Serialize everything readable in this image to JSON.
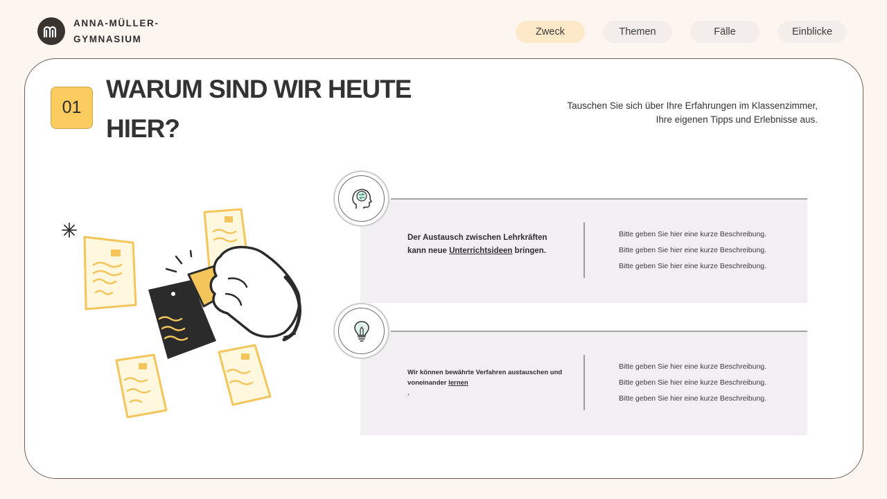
{
  "header": {
    "brand_name": "ANNA-MÜLLER-GYMNASIUM",
    "nav": [
      {
        "label": "Zweck",
        "active": true
      },
      {
        "label": "Themen",
        "active": false
      },
      {
        "label": "Fälle",
        "active": false
      },
      {
        "label": "Einblicke",
        "active": false
      }
    ]
  },
  "slide": {
    "number": "01",
    "title": "WARUM SIND WIR HEUTE HIER?",
    "subtitle_line1": "Tauschen Sie sich über Ihre Erfahrungen im Klassenzimmer,",
    "subtitle_line2": "Ihre eigenen Tipps und Erlebnisse aus."
  },
  "rows": [
    {
      "icon": "head-exchange-icon",
      "text_before": "Der Austausch zwischen Lehrkräften kann neue ",
      "text_link": "Unterrichtsideen",
      "text_after": " bringen.",
      "descriptions": [
        "Bitte geben Sie hier eine kurze Beschreibung.",
        "Bitte geben Sie hier eine kurze Beschreibung.",
        "Bitte geben Sie hier eine kurze Beschreibung."
      ]
    },
    {
      "icon": "lightbulb-icon",
      "text_before": "Wir können bewährte Verfahren austauschen und voneinander ",
      "text_link": "lernen",
      "text_after": "",
      "text_extra": ".",
      "descriptions": [
        "Bitte geben Sie hier eine kurze Beschreibung.",
        "Bitte geben Sie hier eine kurze Beschreibung.",
        "Bitte geben Sie hier eine kurze Beschreibung."
      ]
    }
  ],
  "colors": {
    "accent": "#fccc5f",
    "background": "#fdf5ef",
    "nav_active": "#fbe9c8"
  }
}
